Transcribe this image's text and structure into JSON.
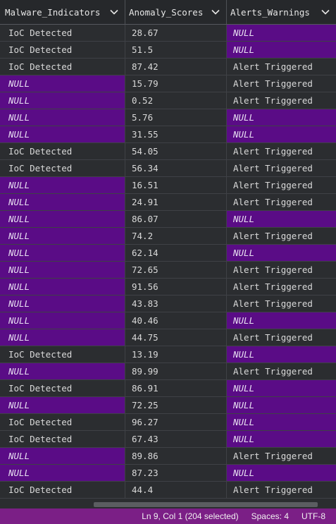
{
  "columns": [
    {
      "label": "Malware_Indicators",
      "icon": "chevron-down-icon"
    },
    {
      "label": "Anomaly_Scores",
      "icon": "chevron-down-icon"
    },
    {
      "label": "Alerts_Warnings",
      "icon": "chevron-down-icon"
    }
  ],
  "rows": [
    [
      "IoC Detected",
      "28.67",
      "NULL"
    ],
    [
      "IoC Detected",
      "51.5",
      "NULL"
    ],
    [
      "IoC Detected",
      "87.42",
      "Alert Triggered"
    ],
    [
      "NULL",
      "15.79",
      "Alert Triggered"
    ],
    [
      "NULL",
      "0.52",
      "Alert Triggered"
    ],
    [
      "NULL",
      "5.76",
      "NULL"
    ],
    [
      "NULL",
      "31.55",
      "NULL"
    ],
    [
      "IoC Detected",
      "54.05",
      "Alert Triggered"
    ],
    [
      "IoC Detected",
      "56.34",
      "Alert Triggered"
    ],
    [
      "NULL",
      "16.51",
      "Alert Triggered"
    ],
    [
      "NULL",
      "24.91",
      "Alert Triggered"
    ],
    [
      "NULL",
      "86.07",
      "NULL"
    ],
    [
      "NULL",
      "74.2",
      "Alert Triggered"
    ],
    [
      "NULL",
      "62.14",
      "NULL"
    ],
    [
      "NULL",
      "72.65",
      "Alert Triggered"
    ],
    [
      "NULL",
      "91.56",
      "Alert Triggered"
    ],
    [
      "NULL",
      "43.83",
      "Alert Triggered"
    ],
    [
      "NULL",
      "40.46",
      "NULL"
    ],
    [
      "NULL",
      "44.75",
      "Alert Triggered"
    ],
    [
      "IoC Detected",
      "13.19",
      "NULL"
    ],
    [
      "NULL",
      "89.99",
      "Alert Triggered"
    ],
    [
      "IoC Detected",
      "86.91",
      "NULL"
    ],
    [
      "NULL",
      "72.25",
      "NULL"
    ],
    [
      "IoC Detected",
      "96.27",
      "NULL"
    ],
    [
      "IoC Detected",
      "67.43",
      "NULL"
    ],
    [
      "NULL",
      "89.86",
      "Alert Triggered"
    ],
    [
      "NULL",
      "87.23",
      "NULL"
    ],
    [
      "IoC Detected",
      "44.4",
      "Alert Triggered"
    ]
  ],
  "null_color": "#5a0c86",
  "status_bar": {
    "position": "Ln 9, Col 1 (204 selected)",
    "spaces": "Spaces: 4",
    "encoding": "UTF-8",
    "background": "#7b1f86"
  }
}
